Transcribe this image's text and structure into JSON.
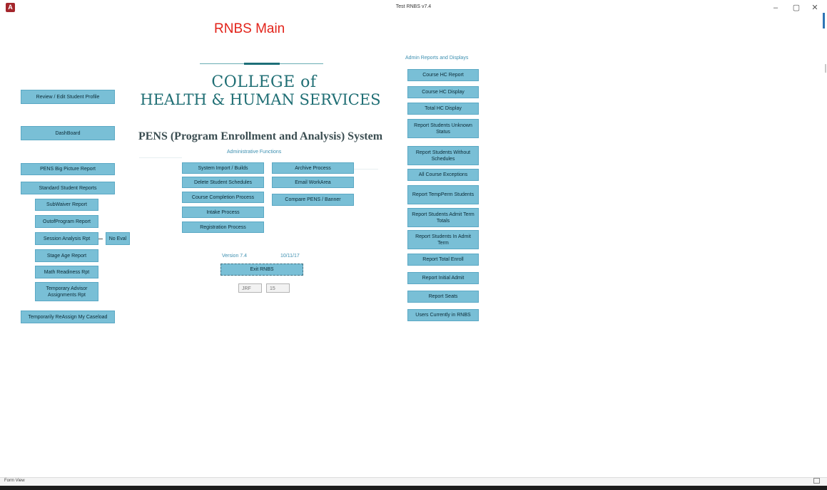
{
  "window": {
    "title": "Test RNBS v7.4",
    "icon_label": "A",
    "minimize": "–",
    "maximize": "▢",
    "close": "✕"
  },
  "form": {
    "heading": "RNBS Main"
  },
  "logo": {
    "line1": "COLLEGE of",
    "line2": "HEALTH & HUMAN SERVICES"
  },
  "system_title": "PENS (Program Enrollment and Analysis) System",
  "left_buttons": {
    "review_profile": "Review / Edit Student Profile",
    "dashboard": "DashBoard",
    "big_picture": "PENS Big Picture Report",
    "standard_reports": "Standard Student Reports",
    "subwaiver": "SubWaiver Report",
    "outofprogram": "OutofProgram Report",
    "session_analysis": "Session Analysis Rpt",
    "no_eval": "No Eval",
    "stage_age": "Stage Age Report",
    "math_readiness": "Math Readiness Rpt",
    "temp_advisor": "Temporary Advisor Assignments Rpt",
    "reassign_caseload": "Temporarily ReAssign My Caseload"
  },
  "admin_functions": {
    "label": "Administrative Functions",
    "system_import": "System Import / Builds",
    "delete_schedules": "Delete Student Schedules",
    "course_completion": "Course Completion Process",
    "intake": "Intake Process",
    "registration": "Registration Process",
    "archive": "Archive Process",
    "email_workarea": "Email WorkArea",
    "compare": "Compare PENS / Banner"
  },
  "version": {
    "label": "Version 7.4",
    "date": "10/11/17",
    "exit": "Exit RNBS",
    "user_field": "JRF",
    "number_field": "15"
  },
  "admin_reports": {
    "label": "Admin Reports and Displays",
    "course_hc_report": "Course HC Report",
    "course_hc_display": "Course HC Display",
    "total_hc_display": "Total HC Display",
    "unknown_status": "Report Students Unknown Status",
    "without_schedules": "Report Students Without Schedules",
    "all_course_exceptions": "All Course Exceptions",
    "tempperm": "Report TempPerm Students",
    "admit_term_totals": "Report Students Admit Term Totals",
    "in_admit_term": "Report Students In Admit Term",
    "total_enroll": "Report Total Enroll",
    "initial_admit": "Report Initial Admit",
    "seats": "Report Seats",
    "users_currently": "Users Currently in RNBS"
  },
  "status_bar": {
    "view": "Form View"
  }
}
